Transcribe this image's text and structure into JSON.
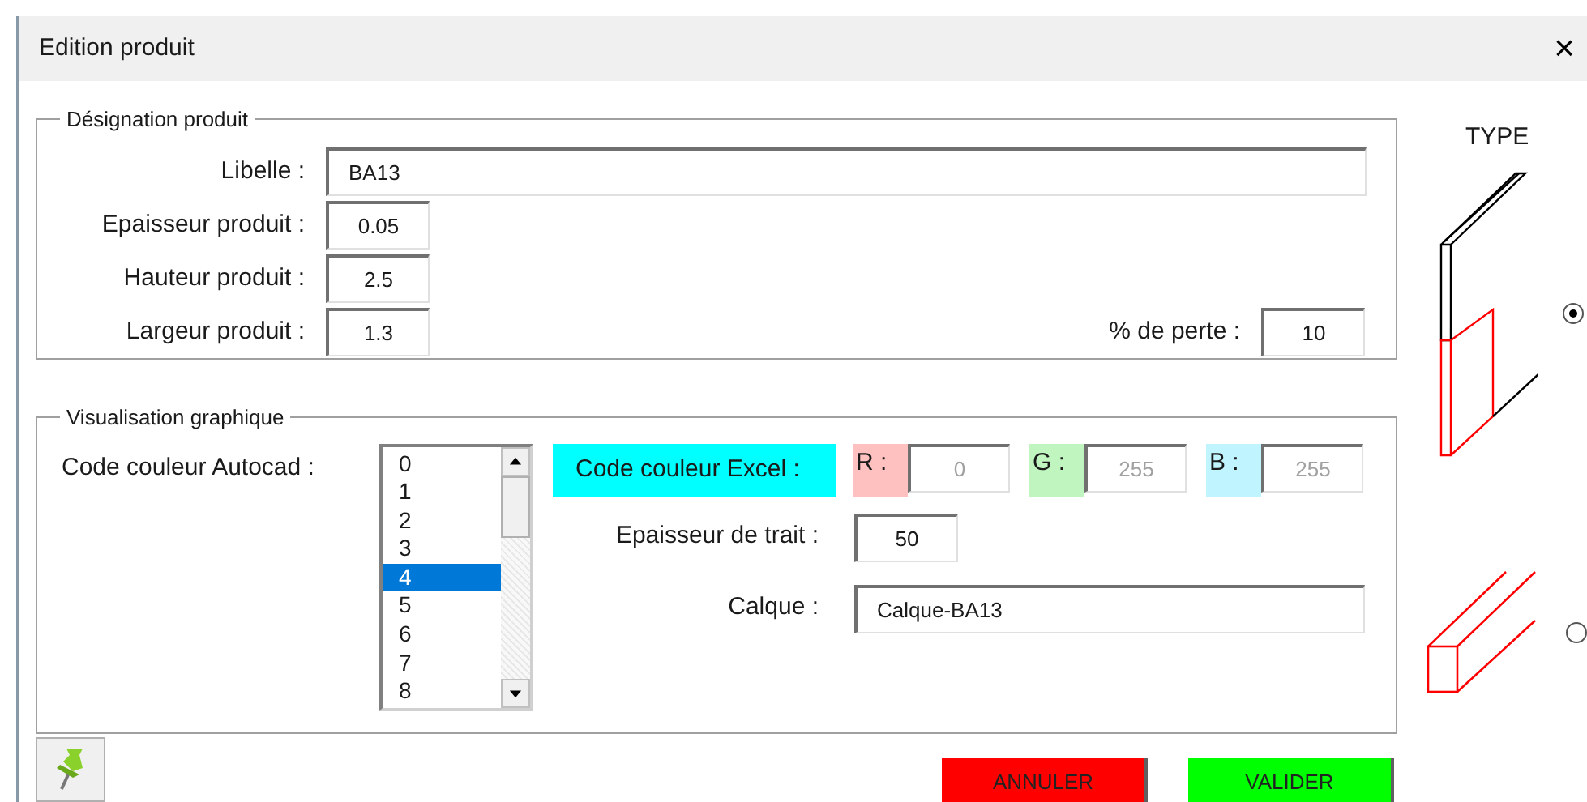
{
  "window": {
    "title": "Edition produit",
    "close": "×"
  },
  "designation": {
    "legend": "Désignation produit",
    "libelle": {
      "label": "Libelle :",
      "value": "BA13"
    },
    "fields": [
      {
        "label": "Epaisseur produit :",
        "value": "0.05"
      },
      {
        "label": "Hauteur produit :",
        "value": "2.5"
      },
      {
        "label": "Largeur produit :",
        "value": "1.3"
      }
    ],
    "perte": {
      "label": "% de perte :",
      "value": "10"
    }
  },
  "visualisation": {
    "legend": "Visualisation graphique",
    "autocad": {
      "label": "Code couleur Autocad :",
      "items": [
        {
          "text": "0",
          "selected": false
        },
        {
          "text": "1",
          "selected": false
        },
        {
          "text": "2",
          "selected": false
        },
        {
          "text": "3",
          "selected": false
        },
        {
          "text": "4",
          "selected": true
        },
        {
          "text": "5",
          "selected": false
        },
        {
          "text": "6",
          "selected": false
        },
        {
          "text": "7",
          "selected": false
        },
        {
          "text": "8",
          "selected": false
        }
      ]
    },
    "excel": {
      "label": "Code couleur Excel :",
      "color": "#00ffff"
    },
    "rgb": [
      {
        "label": "R :",
        "value": "0",
        "color": "#ffc0c0",
        "disabled": true
      },
      {
        "label": "G :",
        "value": "255",
        "color": "#c0f5c0",
        "disabled": true
      },
      {
        "label": "B :",
        "value": "255",
        "color": "#c0f5ff",
        "disabled": true
      }
    ],
    "trait": {
      "label": "Epaisseur de trait :",
      "value": "50"
    },
    "calque": {
      "label": "Calque :",
      "value": "Calque-BA13"
    }
  },
  "type": {
    "title": "TYPE",
    "options": [
      {
        "kind": "panel",
        "selected": true
      },
      {
        "kind": "beam",
        "selected": false
      }
    ]
  },
  "buttons": [
    {
      "label": "ANNULER",
      "color": "#ff0000"
    },
    {
      "label": "VALIDER",
      "color": "#00ff00"
    }
  ]
}
